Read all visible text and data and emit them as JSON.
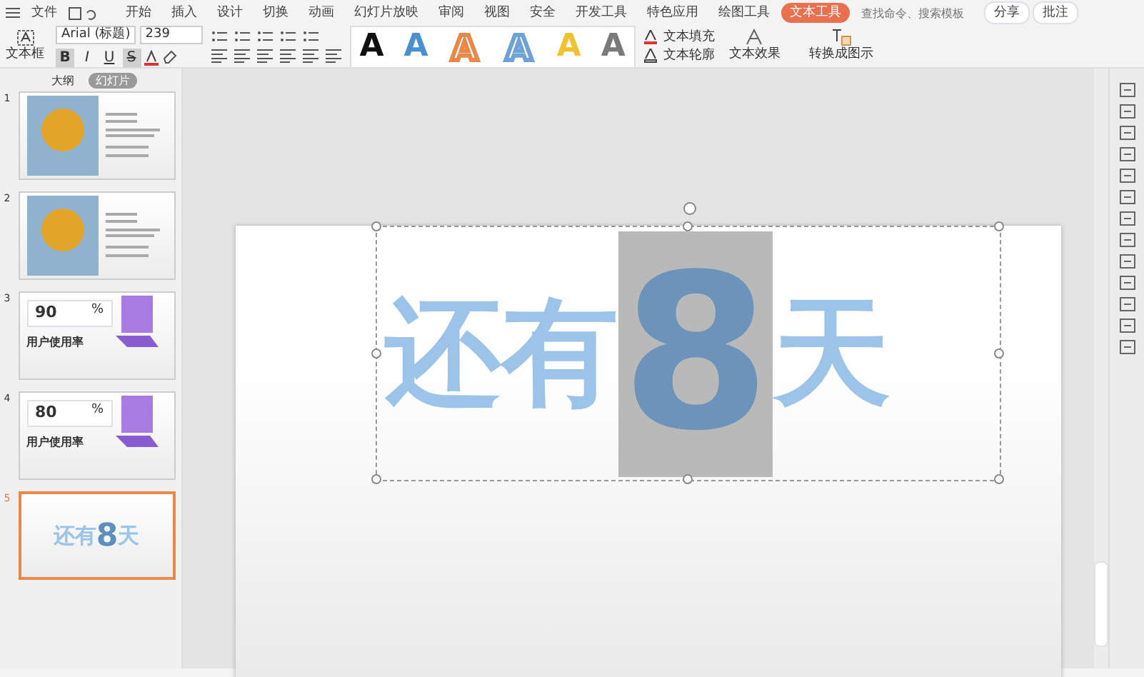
{
  "menu_bar": {
    "file_label": "文件",
    "tabs": [
      {
        "label": "开始",
        "selected": false
      },
      {
        "label": "插入",
        "selected": false
      },
      {
        "label": "设计",
        "selected": false
      },
      {
        "label": "切换",
        "selected": false
      },
      {
        "label": "动画",
        "selected": false
      },
      {
        "label": "幻灯片放映",
        "selected": false
      },
      {
        "label": "审阅",
        "selected": false
      },
      {
        "label": "视图",
        "selected": false
      },
      {
        "label": "安全",
        "selected": false
      },
      {
        "label": "开发工具",
        "selected": false
      },
      {
        "label": "特色应用",
        "selected": false
      },
      {
        "label": "绘图工具",
        "selected": false
      },
      {
        "label": "文本工具",
        "selected": true
      }
    ],
    "search": {
      "placeholder": "查找命令、搜索模板"
    },
    "actions": [
      "分享",
      "批注"
    ]
  },
  "ribbon": {
    "text_box": "文本框",
    "font": "Arial (标题)",
    "font_size": "239",
    "format_buttons": [
      {
        "label": "B",
        "selected": true
      },
      {
        "label": "I",
        "selected": false
      },
      {
        "label": "U",
        "selected": false
      },
      {
        "label": "S",
        "selected": true
      }
    ],
    "text_styles": [
      {
        "label": "A",
        "kind": "filled",
        "color": "#111111"
      },
      {
        "label": "A",
        "kind": "filled",
        "color": "#4a8fcf"
      },
      {
        "label": "A",
        "kind": "outline"
      },
      {
        "label": "A",
        "kind": "outline"
      },
      {
        "label": "A",
        "kind": "filled",
        "color": "#f2c12e"
      },
      {
        "label": "A",
        "kind": "filled",
        "color": "#7a7a7a"
      }
    ],
    "fill_label": "文本填充",
    "outline_label": "文本轮廓",
    "effect_label": "文本效果",
    "convert_label": "转换成图示"
  },
  "panel": {
    "tabs": [
      {
        "label": "大纲",
        "selected": false
      },
      {
        "label": "幻灯片",
        "selected": true
      }
    ],
    "slides": [
      {
        "number": "1",
        "kind": "photo",
        "selected": false
      },
      {
        "number": "2",
        "kind": "photo",
        "selected": false
      },
      {
        "number": "3",
        "kind": "percent",
        "value": "90",
        "unit": "%",
        "title": "用户使用率",
        "selected": false
      },
      {
        "number": "4",
        "kind": "percent",
        "value": "80",
        "unit": "%",
        "title": "用户使用率",
        "selected": false
      },
      {
        "number": "5",
        "kind": "countdown",
        "before": "还有",
        "digit": "8",
        "after": "天",
        "selected": true
      }
    ]
  },
  "slide": {
    "before": "还有",
    "digit": "8",
    "after": "天"
  }
}
